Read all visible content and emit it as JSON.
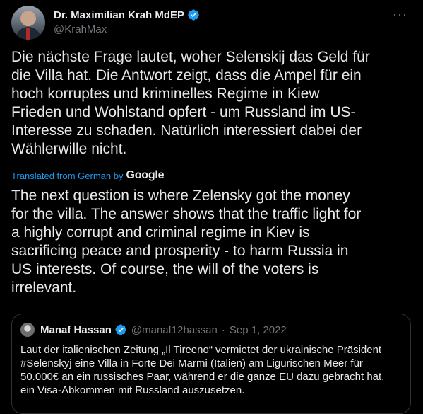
{
  "author": {
    "name": "Dr. Maximilian Krah MdEP",
    "handle": "@KrahMax"
  },
  "more_glyph": "···",
  "tweet": {
    "text": "Die nächste Frage lautet, woher Selenskij das Geld für\ndie Villa hat. Die Antwort zeigt, dass die Ampel für ein\nhoch korruptes und kriminelles Regime in Kiew\nFrieden und Wohlstand opfert - um Russland im US-\nInteresse zu schaden. Natürlich interessiert dabei der\nWählerwille nicht.",
    "translated_label": "Translated from German by",
    "translator": "Google",
    "translation": "The next question is where Zelensky got the money\nfor the villa. The answer shows that the traffic light for\na highly corrupt and criminal regime in Kiev is\nsacrificing peace and prosperity - to harm Russia in\nUS interests. Of course, the will of the voters is\nirrelevant."
  },
  "quote": {
    "name": "Manaf Hassan",
    "handle": "@manaf12hassan",
    "separator": "·",
    "date": "Sep 1, 2022",
    "text": "Laut der italienischen Zeitung „Il Tireeno“ vermietet der ukrainische Präsident\n#Selenskyj eine Villa in Forte Dei Marmi (Italien) am Ligurischen Meer für\n50.000€ an ein russisches Paar, während er die ganze EU dazu gebracht hat,\nein Visa-Abkommen mit Russland auszusetzen."
  },
  "colors": {
    "background": "#000000",
    "text": "#e7e9ea",
    "muted": "#71767b",
    "accent": "#1d9bf0",
    "border": "#2f3336"
  },
  "icons": [
    "verified-badge-icon",
    "more-options-icon"
  ]
}
